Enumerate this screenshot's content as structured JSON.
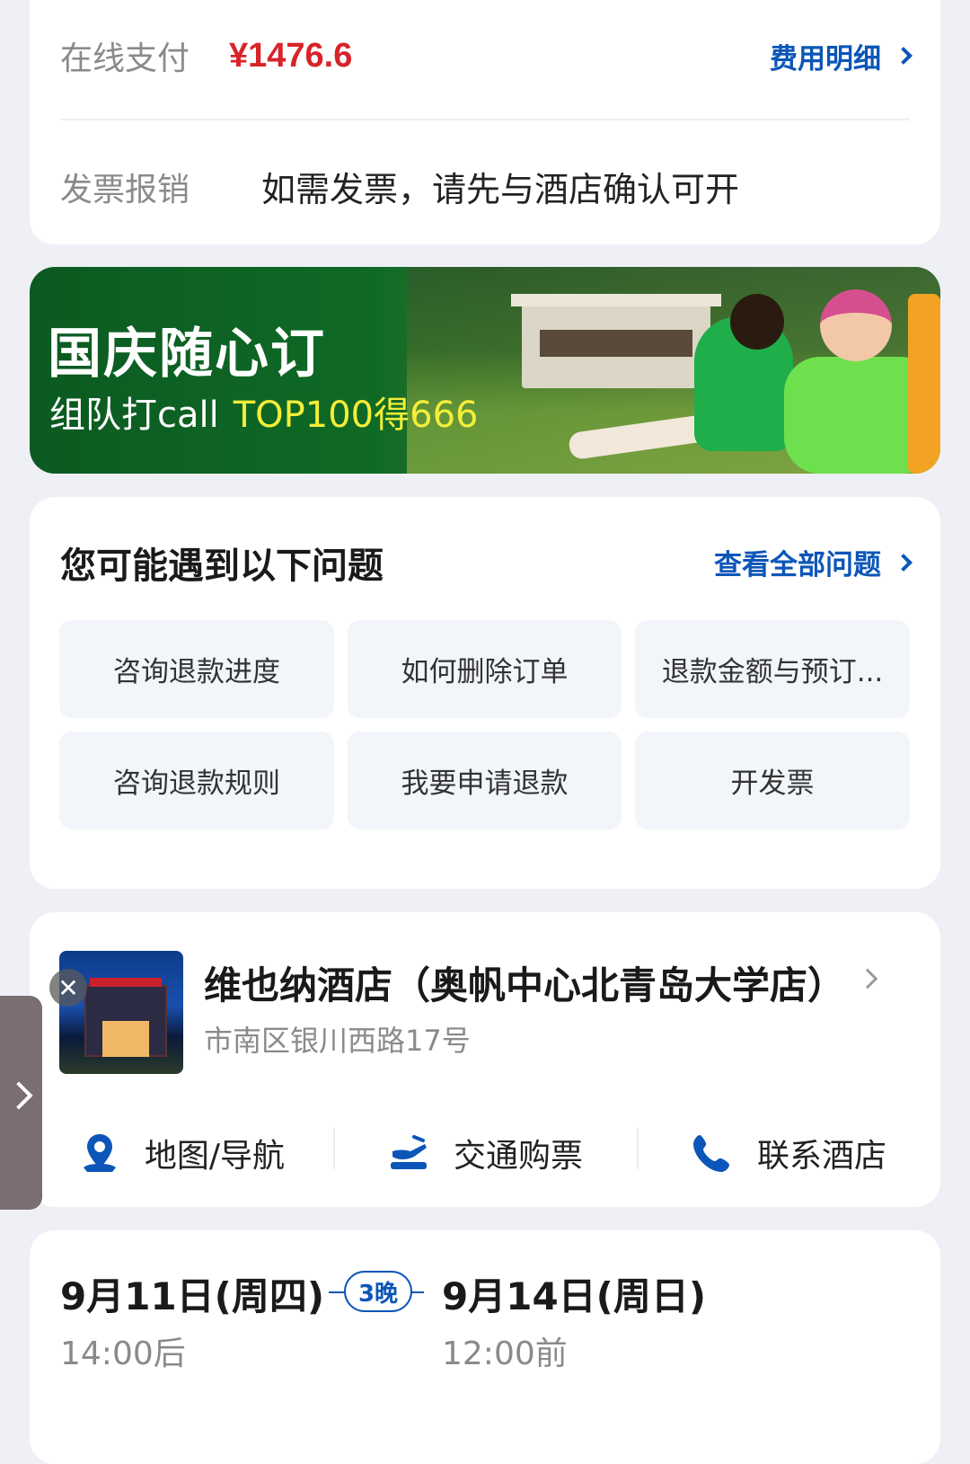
{
  "payment": {
    "label": "在线支付",
    "amount": "¥1476.6",
    "detail_link": "费用明细"
  },
  "invoice": {
    "label": "发票报销",
    "text": "如需发票，请先与酒店确认可开"
  },
  "banner": {
    "title": "国庆随心订",
    "subtitle": "组队打call",
    "highlight": "TOP100得666"
  },
  "faq": {
    "title": "您可能遇到以下问题",
    "view_all": "查看全部问题",
    "items": [
      "咨询退款进度",
      "如何删除订单",
      "退款金额与预订...",
      "咨询退款规则",
      "我要申请退款",
      "开发票"
    ]
  },
  "hotel": {
    "name": "维也纳酒店（奥帆中心北青岛大学店）",
    "address": "市南区银川西路17号",
    "actions": [
      {
        "label": "地图/导航",
        "icon": "map-pin-icon"
      },
      {
        "label": "交通购票",
        "icon": "transport-ticket-icon"
      },
      {
        "label": "联系酒店",
        "icon": "phone-icon"
      }
    ]
  },
  "stay": {
    "checkin_date": "9月11日(周四)",
    "checkin_time": "14:00后",
    "nights": "3晚",
    "checkout_date": "9月14日(周日)",
    "checkout_time": "12:00前"
  },
  "colors": {
    "accent_blue": "#0b56b8",
    "price_red": "#d8232a",
    "banner_highlight": "#f4ee38"
  }
}
